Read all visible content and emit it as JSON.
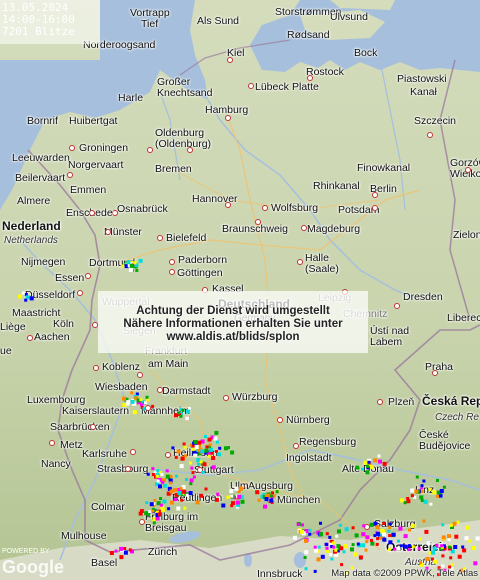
{
  "stamp": {
    "date": "13.05.2024",
    "time_range": "14:00-16:00",
    "strike_count": "7201 Blitze"
  },
  "notice": {
    "line1": "Achtung der Dienst wird umgestellt",
    "line2": "Nähere Informationen erhalten Sie unter",
    "line3": "www.aldis.at/blids/splon"
  },
  "attribution": {
    "powered_by": "POWERED BY",
    "logo": "Google",
    "copyright": "Map data ©2009 PPWK, Tele Atlas"
  },
  "colors": {
    "water": "#a5bfdd",
    "land_north": "#cfd8b6",
    "land_south": "#b9c99a",
    "alps": "#e6e4dc",
    "city_outline": "#c23333"
  },
  "strike_colors": [
    "#ff0000",
    "#00aa00",
    "#0000ff",
    "#ffff00",
    "#ff00ff",
    "#00dddd",
    "#ff8800",
    "#ffffff"
  ],
  "labels": {
    "vortrapp": "Vortrapp",
    "tief": "Tief",
    "als_sund": "Als Sund",
    "storstrommen": "Storstrømmen",
    "ulvsund": "Ulvsund",
    "rodsand": "Rødsand",
    "nordeeroogsand": "Norderoogsand",
    "kiel": "Kiel",
    "bock": "Bock",
    "rostock": "Rostock",
    "piastowski": "Piastowski",
    "kanal": "Kanał",
    "grosser_knechtsand": "Großer\nKnechtsand",
    "lubeck": "Lübeck",
    "platte": "Platte",
    "harle": "Harle",
    "bornrif": "Bornrif",
    "huibertgat": "Huibertgat",
    "hamburg": "Hamburg",
    "szczecin": "Szczecin",
    "oldenburg": "Oldenburg\n(Oldenburg)",
    "groningen": "Groningen",
    "leeuwarden": "Leeuwarden",
    "norgervaart": "Norgervaart",
    "bremen": "Bremen",
    "finowkanal": "Finowkanal",
    "gorzow": "Gorzów\nWielkopolski",
    "beilervaart": "Beilervaart",
    "emmen": "Emmen",
    "rhinkanal": "Rhinkanal",
    "berlin": "Berlin",
    "almere": "Almere",
    "hannover": "Hannover",
    "osnabruck": "Osnabrück",
    "wolfsburg": "Wolfsburg",
    "potsdam": "Potsdam",
    "enschede": "Enschede",
    "nederland": "Nederland",
    "netherlands": "Netherlands",
    "braunschweig": "Braunschweig",
    "magdeburg": "Magdeburg",
    "munster": "Münster",
    "bielefeld": "Bielefeld",
    "zielona": "Zielona",
    "nijmegen": "Nijmegen",
    "dortmund": "Dortmund",
    "paderborn": "Paderborn",
    "halle": "Halle\n(Saale)",
    "gottingen": "Göttingen",
    "essen": "Essen",
    "kassel": "Kassel",
    "leipzig": "Leipzig",
    "dresden": "Dresden",
    "dusseldorf": "Düsseldorf",
    "wuppertal": "Wuppertal",
    "deutschland": "Deutschland",
    "germany": "Germany",
    "chemnitz": "Chemnitz",
    "maastricht": "Maastricht",
    "koln": "Köln",
    "liberec": "Liberec",
    "liege": "Liège",
    "aachen": "Aachen",
    "siegen": "Siegen",
    "usti": "Ústí nad\nLabem",
    "frankfurt": "Frankfurt",
    "koblenz": "Koblenz",
    "am_main": "am Main",
    "praha": "Praha",
    "wiesbaden": "Wiesbaden",
    "luxembourg": "Luxembourg",
    "darmstadt": "Darmstadt",
    "wurzburg": "Würzburg",
    "plzen": "Plzeň",
    "ceska": "Česká Rep",
    "czech": "Czech Re",
    "kaiserslautern": "Kaiserslautern",
    "mannheim": "Mannheim",
    "saarbrucken": "Saarbrücken",
    "nurnberg": "Nürnberg",
    "metz": "Metz",
    "regensburg": "Regensburg",
    "ceske": "České\nBudějovice",
    "karlsruhe": "Karlsruhe",
    "heilbronn": "Heilbronn",
    "ingolstadt": "Ingolstadt",
    "nancy": "Nancy",
    "stuttgart": "Stuttgart",
    "alte_donau": "Alte Donau",
    "strasbourg": "Strasbourg",
    "augsburg": "Augsburg",
    "linz": "Linz",
    "reutlingen": "Reutlingen",
    "ulm": "Ulm",
    "munchen": "München",
    "colmar": "Colmar",
    "freiburg": "Freiburg im\nBreisgau",
    "mulhouse": "Mulhouse",
    "salzburg": "Salzburg",
    "basel": "Basel",
    "zurich": "Zürich",
    "innsbruck": "Innsbruck",
    "osterreich": "Österreich",
    "austria": "Austria",
    "ue": "ue"
  }
}
